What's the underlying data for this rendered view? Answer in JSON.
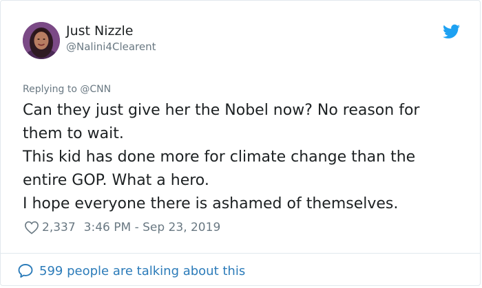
{
  "user": {
    "display_name": "Just Nizzle",
    "handle": "@Nalini4Clearent"
  },
  "reply": {
    "text": "Replying to @CNN"
  },
  "tweet": {
    "lines": [
      "Can they just give her the Nobel now? No reason for them to wait.",
      "This kid has done more for climate change than the entire GOP. What a hero.",
      "I hope everyone there is ashamed of themselves."
    ]
  },
  "meta": {
    "likes": "2,337",
    "timestamp": "3:46 PM - Sep 23, 2019"
  },
  "footer": {
    "text": "599 people are talking about this"
  },
  "icons": {
    "brand": "twitter-bird-icon",
    "like": "heart-icon",
    "conversation": "speech-bubble-icon"
  },
  "colors": {
    "brand_blue": "#1da1f2",
    "link_blue": "#2b7bb9",
    "secondary_text": "#697882",
    "primary_text": "#1c2022",
    "border": "#e1e8ed"
  }
}
